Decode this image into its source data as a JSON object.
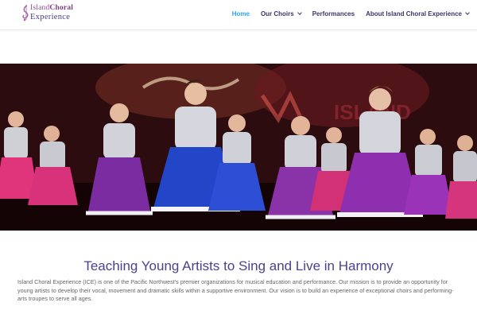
{
  "brand": {
    "line1_prefix": "Island",
    "line1_bold": "Choral",
    "line2": "Experience"
  },
  "nav": {
    "items": [
      {
        "label": "Home",
        "active": true,
        "dropdown": false
      },
      {
        "label": "Our Choirs",
        "active": false,
        "dropdown": true
      },
      {
        "label": "Performances",
        "active": false,
        "dropdown": false
      },
      {
        "label": "About Island Choral Experience",
        "active": false,
        "dropdown": true
      }
    ],
    "active_color": "#2ea3f2",
    "text_color": "#3c3565"
  },
  "hero": {
    "description": "Photo of young performers in silver jackets and sequined dresses dancing on stage"
  },
  "content": {
    "title": "Teaching Young Artists to Sing and Live in Harmony",
    "body": "Island Choral Experience (ICE) is one of the Pacific Northwest's premier organizations for musical education and performance. Our mission is to provide an opportunity for young artists to develop their vocal, movement and dramatic skills within a supportive environment. Our vision is to build an experience of exceptional choirs and performing-arts troupes to serve all ages."
  },
  "colors": {
    "title": "#4e3f8e",
    "body_text": "#666666"
  }
}
